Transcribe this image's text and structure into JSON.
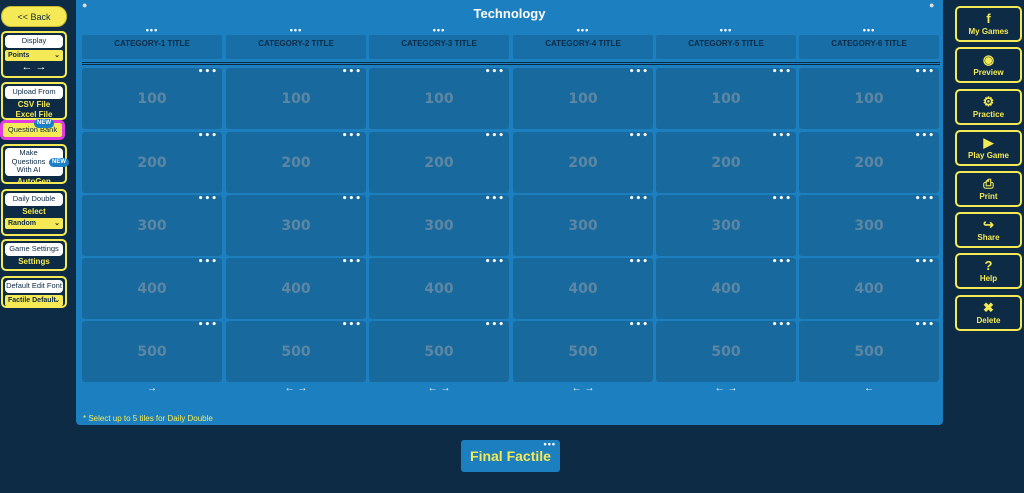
{
  "left": {
    "back_label": "<< Back",
    "display": {
      "title": "Display",
      "value": "Points",
      "arrows": "← →"
    },
    "upload": {
      "title": "Upload From",
      "csv": "CSV File",
      "excel": "Excel File"
    },
    "question_bank": {
      "label": "Question Bank",
      "badge": "NEW"
    },
    "ai": {
      "title": "Make Questions With AI",
      "badge": "NEW",
      "label": "AutoGen"
    },
    "daily_double": {
      "title": "Daily Double",
      "label": "Select",
      "value": "Random"
    },
    "game_settings": {
      "title": "Game Settings",
      "label": "Settings"
    },
    "font": {
      "title": "Default Edit Font",
      "value": "Factile Default"
    }
  },
  "board": {
    "title": "Technology",
    "categories": [
      "CATEGORY-1 TITLE",
      "CATEGORY-2 TITLE",
      "CATEGORY-3 TITLE",
      "CATEGORY-4 TITLE",
      "CATEGORY-5 TITLE",
      "CATEGORY-6 TITLE"
    ],
    "points": [
      "100",
      "200",
      "300",
      "400",
      "500"
    ],
    "column_arrows": [
      "→",
      "← →",
      "← →",
      "← →",
      "← →",
      "←"
    ],
    "dots": "•••",
    "footnote": "* Select up to 5 tiles for Daily Double"
  },
  "right": [
    {
      "label": "My Games",
      "icon": "facebook-icon",
      "glyph": "f"
    },
    {
      "label": "Preview",
      "icon": "eye-icon",
      "glyph": "◉"
    },
    {
      "label": "Practice",
      "icon": "gears-icon",
      "glyph": "⚙"
    },
    {
      "label": "Play Game",
      "icon": "play-icon",
      "glyph": "▶"
    },
    {
      "label": "Print",
      "icon": "printer-icon",
      "glyph": "⎙"
    },
    {
      "label": "Share",
      "icon": "share-icon",
      "glyph": "↪"
    },
    {
      "label": "Help",
      "icon": "help-icon",
      "glyph": "?"
    },
    {
      "label": "Delete",
      "icon": "trash-icon",
      "glyph": "✖"
    }
  ],
  "final_label": "Final Factile",
  "colors": {
    "background": "#0d2b45",
    "accent": "#f5ea55",
    "board": "#1b7fc0",
    "tile": "#186a9e",
    "highlight": "#e23be2"
  }
}
